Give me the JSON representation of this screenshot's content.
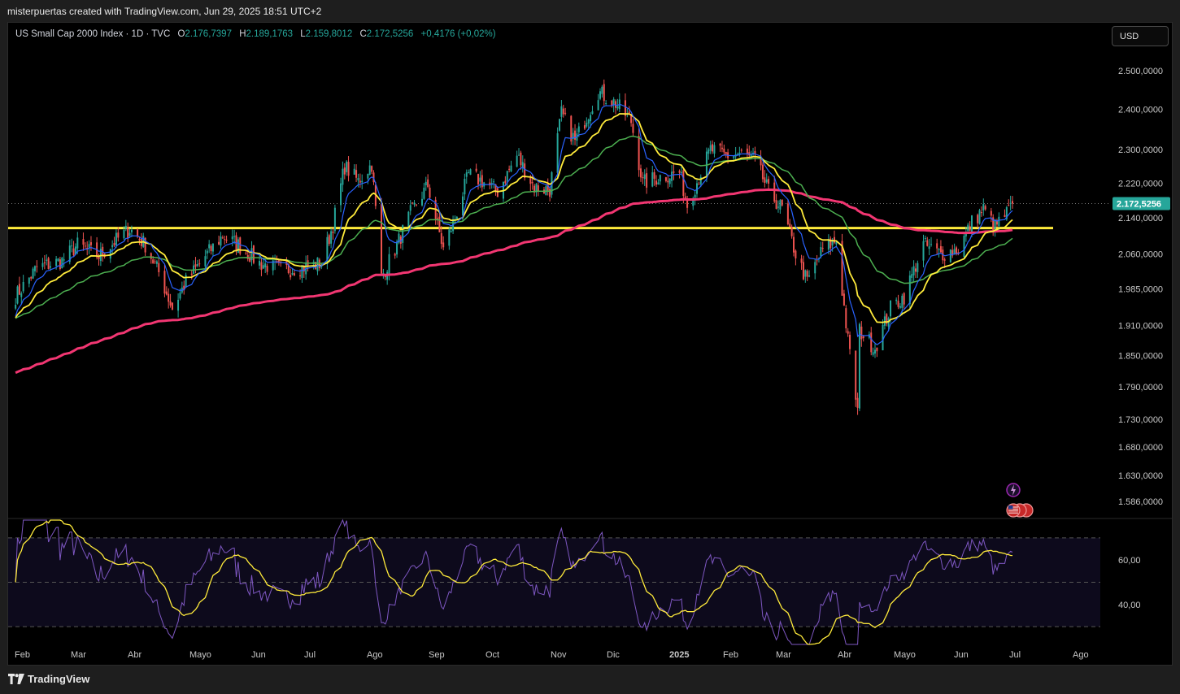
{
  "caption": "misterpuertas created with TradingView.com, Jun 29, 2025 18:51 UTC+2",
  "legend": {
    "symbol": "US Small Cap 2000 Index · 1D · TVC",
    "open_label": "O",
    "open": "2.176,7397",
    "high_label": "H",
    "high": "2.189,1763",
    "low_label": "L",
    "low": "2.159,8012",
    "close_label": "C",
    "close": "2.172,5256",
    "change": "+0,4176 (+0,02%)"
  },
  "currency_button": "USD",
  "footer_brand": "TradingView",
  "colors": {
    "up": "#26a69a",
    "down": "#ef5350",
    "ema_fast": "#2962ff",
    "ema_mid": "#ffeb3b",
    "ema_slow": "#4caf50",
    "ema_long": "#f23672",
    "support": "#ffeb3b",
    "rsi": "#7e57c2",
    "rsi_ma": "#ffeb3b",
    "price_label_bg": "#26a69a"
  },
  "chart_data": {
    "type": "candlestick",
    "price_axis": {
      "ticks": [
        2500,
        2400,
        2300,
        2220,
        2140,
        2060,
        1985,
        1910,
        1850,
        1790,
        1730,
        1680,
        1630,
        1586
      ],
      "tick_labels": [
        "2.500,0000",
        "2.400,0000",
        "2.300,0000",
        "2.220,0000",
        "2.140,0000",
        "2.060,0000",
        "1.985,0000",
        "1.910,0000",
        "1.850,0000",
        "1.790,0000",
        "1.730,0000",
        "1.680,0000",
        "1.630,0000",
        "1.586,0000"
      ],
      "last_price": 2172.5256,
      "last_price_label": "2.172,5256",
      "scale": "log"
    },
    "time_axis": {
      "labels": [
        "Feb",
        "Mar",
        "Abr",
        "Mayo",
        "Jun",
        "Jul",
        "Ago",
        "Sep",
        "Oct",
        "Nov",
        "Dic",
        "2025",
        "Feb",
        "Mar",
        "Abr",
        "Mayo",
        "Jun",
        "Jul",
        "Ago"
      ],
      "bold_label": "2025"
    },
    "support_level": 2117,
    "close_path": [
      {
        "date": "2024-01-29",
        "close": 1970
      },
      {
        "date": "2024-02-09",
        "close": 2030
      },
      {
        "date": "2024-02-22",
        "close": 2045
      },
      {
        "date": "2024-03-01",
        "close": 2080
      },
      {
        "date": "2024-03-12",
        "close": 2055
      },
      {
        "date": "2024-03-21",
        "close": 2090
      },
      {
        "date": "2024-03-28",
        "close": 2115
      },
      {
        "date": "2024-04-05",
        "close": 2080
      },
      {
        "date": "2024-04-12",
        "close": 2020
      },
      {
        "date": "2024-04-19",
        "close": 1945
      },
      {
        "date": "2024-04-26",
        "close": 2000
      },
      {
        "date": "2024-05-06",
        "close": 2055
      },
      {
        "date": "2024-05-15",
        "close": 2100
      },
      {
        "date": "2024-05-23",
        "close": 2080
      },
      {
        "date": "2024-06-03",
        "close": 2040
      },
      {
        "date": "2024-06-14",
        "close": 2025
      },
      {
        "date": "2024-06-24",
        "close": 2030
      },
      {
        "date": "2024-07-05",
        "close": 2040
      },
      {
        "date": "2024-07-11",
        "close": 2125
      },
      {
        "date": "2024-07-17",
        "close": 2260
      },
      {
        "date": "2024-07-24",
        "close": 2225
      },
      {
        "date": "2024-07-31",
        "close": 2265
      },
      {
        "date": "2024-08-05",
        "close": 2010
      },
      {
        "date": "2024-08-12",
        "close": 2070
      },
      {
        "date": "2024-08-20",
        "close": 2150
      },
      {
        "date": "2024-08-29",
        "close": 2215
      },
      {
        "date": "2024-09-06",
        "close": 2070
      },
      {
        "date": "2024-09-12",
        "close": 2140
      },
      {
        "date": "2024-09-19",
        "close": 2240
      },
      {
        "date": "2024-09-26",
        "close": 2225
      },
      {
        "date": "2024-10-04",
        "close": 2200
      },
      {
        "date": "2024-10-14",
        "close": 2285
      },
      {
        "date": "2024-10-23",
        "close": 2210
      },
      {
        "date": "2024-10-31",
        "close": 2205
      },
      {
        "date": "2024-11-06",
        "close": 2390
      },
      {
        "date": "2024-11-13",
        "close": 2320
      },
      {
        "date": "2024-11-25",
        "close": 2445
      },
      {
        "date": "2024-12-04",
        "close": 2415
      },
      {
        "date": "2024-12-12",
        "close": 2370
      },
      {
        "date": "2024-12-18",
        "close": 2220
      },
      {
        "date": "2024-12-27",
        "close": 2235
      },
      {
        "date": "2025-01-06",
        "close": 2245
      },
      {
        "date": "2025-01-10",
        "close": 2170
      },
      {
        "date": "2025-01-22",
        "close": 2300
      },
      {
        "date": "2025-01-30",
        "close": 2285
      },
      {
        "date": "2025-02-06",
        "close": 2290
      },
      {
        "date": "2025-02-14",
        "close": 2275
      },
      {
        "date": "2025-02-21",
        "close": 2200
      },
      {
        "date": "2025-02-28",
        "close": 2160
      },
      {
        "date": "2025-03-07",
        "close": 2060
      },
      {
        "date": "2025-03-13",
        "close": 2000
      },
      {
        "date": "2025-03-21",
        "close": 2070
      },
      {
        "date": "2025-03-28",
        "close": 2090
      },
      {
        "date": "2025-04-03",
        "close": 1880
      },
      {
        "date": "2025-04-08",
        "close": 1745
      },
      {
        "date": "2025-04-09",
        "close": 1900
      },
      {
        "date": "2025-04-17",
        "close": 1865
      },
      {
        "date": "2025-04-25",
        "close": 1945
      },
      {
        "date": "2025-05-02",
        "close": 1970
      },
      {
        "date": "2025-05-12",
        "close": 2080
      },
      {
        "date": "2025-05-21",
        "close": 2060
      },
      {
        "date": "2025-05-30",
        "close": 2070
      },
      {
        "date": "2025-06-06",
        "close": 2130
      },
      {
        "date": "2025-06-12",
        "close": 2160
      },
      {
        "date": "2025-06-18",
        "close": 2120
      },
      {
        "date": "2025-06-24",
        "close": 2150
      },
      {
        "date": "2025-06-27",
        "close": 2172.5
      }
    ],
    "moving_averages": [
      {
        "color": "#2962ff",
        "span": 9
      },
      {
        "color": "#ffeb3b",
        "span": 20
      },
      {
        "color": "#4caf50",
        "span": 50
      },
      {
        "color": "#f23672",
        "span": 200
      }
    ],
    "rsi_panel": {
      "tick_labels": [
        "60,00",
        "40,00"
      ],
      "ticks": [
        60,
        40
      ],
      "bands": [
        70,
        50,
        30
      ],
      "range": [
        22,
        78
      ]
    }
  }
}
